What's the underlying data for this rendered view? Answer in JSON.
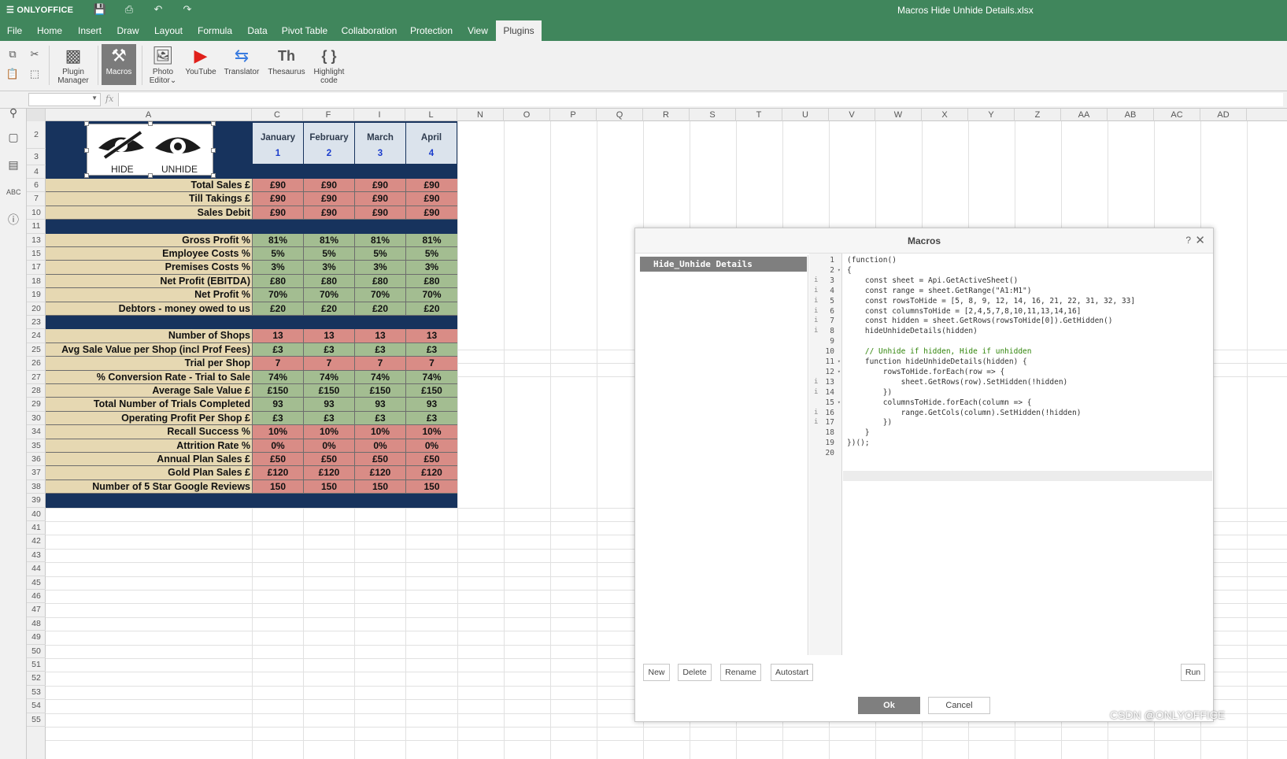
{
  "app": {
    "brand": "ONLYOFFICE",
    "doc_title": "Macros Hide Unhide Details.xlsx"
  },
  "quick_access": {
    "save_icon": "save-icon",
    "print_icon": "print-icon",
    "undo_icon": "undo-icon",
    "redo_icon": "redo-icon"
  },
  "menu": [
    "File",
    "Home",
    "Insert",
    "Draw",
    "Layout",
    "Formula",
    "Data",
    "Pivot Table",
    "Collaboration",
    "Protection",
    "View",
    "Plugins"
  ],
  "active_menu": "Plugins",
  "toolbar": {
    "plugin_manager": [
      "Plugin",
      "Manager"
    ],
    "macros": "Macros",
    "photo_editor": [
      "Photo",
      "Editor"
    ],
    "youtube": "YouTube",
    "translator": "Translator",
    "thesaurus": "Thesaurus",
    "highlight_code": [
      "Highlight",
      "code"
    ]
  },
  "formula_bar": {
    "name_box": "",
    "fx": "fx",
    "value": ""
  },
  "columns": [
    "A",
    "C",
    "F",
    "I",
    "L",
    "N",
    "O",
    "P",
    "Q",
    "R",
    "S",
    "T",
    "U",
    "V",
    "W",
    "X",
    "Y",
    "Z",
    "AA",
    "AB",
    "AC",
    "AD"
  ],
  "rows": [
    "2",
    "3",
    "4",
    "6",
    "7",
    "10",
    "11",
    "13",
    "15",
    "17",
    "18",
    "19",
    "20",
    "23",
    "24",
    "25",
    "26",
    "27",
    "28",
    "29",
    "30",
    "34",
    "35",
    "36",
    "37",
    "38",
    "39",
    "40",
    "41",
    "42",
    "43",
    "44",
    "45",
    "46",
    "47",
    "48",
    "49",
    "50",
    "51",
    "52",
    "53",
    "54",
    "55"
  ],
  "hide_unhide": {
    "hide": "HIDE",
    "unhide": "UNHIDE"
  },
  "months": [
    {
      "name": "January",
      "num": "1"
    },
    {
      "name": "February",
      "num": "2"
    },
    {
      "name": "March",
      "num": "3"
    },
    {
      "name": "April",
      "num": "4"
    }
  ],
  "data_rows": [
    {
      "label": "Total Sales £",
      "values": [
        "£90",
        "£90",
        "£90",
        "£90"
      ],
      "color": "red"
    },
    {
      "label": "Till Takings £",
      "values": [
        "£90",
        "£90",
        "£90",
        "£90"
      ],
      "color": "red"
    },
    {
      "label": "Sales Debit",
      "values": [
        "£90",
        "£90",
        "£90",
        "£90"
      ],
      "color": "red"
    },
    {
      "label": "Gross Profit %",
      "values": [
        "81%",
        "81%",
        "81%",
        "81%"
      ],
      "color": "green"
    },
    {
      "label": "Employee Costs %",
      "values": [
        "5%",
        "5%",
        "5%",
        "5%"
      ],
      "color": "green"
    },
    {
      "label": "Premises Costs %",
      "values": [
        "3%",
        "3%",
        "3%",
        "3%"
      ],
      "color": "green"
    },
    {
      "label": "Net Profit (EBITDA)",
      "values": [
        "£80",
        "£80",
        "£80",
        "£80"
      ],
      "color": "green"
    },
    {
      "label": "Net Profit %",
      "values": [
        "70%",
        "70%",
        "70%",
        "70%"
      ],
      "color": "green"
    },
    {
      "label": "Debtors - money owed to us",
      "values": [
        "£20",
        "£20",
        "£20",
        "£20"
      ],
      "color": "green"
    },
    {
      "label": "Number of Shops",
      "values": [
        "13",
        "13",
        "13",
        "13"
      ],
      "color": "red"
    },
    {
      "label": "Avg Sale Value per Shop (incl Prof Fees)",
      "values": [
        "£3",
        "£3",
        "£3",
        "£3"
      ],
      "color": "green"
    },
    {
      "label": "Trial per Shop",
      "values": [
        "7",
        "7",
        "7",
        "7"
      ],
      "color": "red"
    },
    {
      "label": "% Conversion Rate - Trial to Sale",
      "values": [
        "74%",
        "74%",
        "74%",
        "74%"
      ],
      "color": "green"
    },
    {
      "label": "Average Sale Value £",
      "values": [
        "£150",
        "£150",
        "£150",
        "£150"
      ],
      "color": "green"
    },
    {
      "label": "Total Number of Trials Completed",
      "values": [
        "93",
        "93",
        "93",
        "93"
      ],
      "color": "green"
    },
    {
      "label": "Operating Profit Per Shop £",
      "values": [
        "£3",
        "£3",
        "£3",
        "£3"
      ],
      "color": "green"
    },
    {
      "label": "Recall Success %",
      "values": [
        "10%",
        "10%",
        "10%",
        "10%"
      ],
      "color": "red"
    },
    {
      "label": "Attrition Rate %",
      "values": [
        "0%",
        "0%",
        "0%",
        "0%"
      ],
      "color": "red"
    },
    {
      "label": "Annual Plan Sales £",
      "values": [
        "£50",
        "£50",
        "£50",
        "£50"
      ],
      "color": "red"
    },
    {
      "label": "Gold Plan Sales £",
      "values": [
        "£120",
        "£120",
        "£120",
        "£120"
      ],
      "color": "red"
    },
    {
      "label": "Number of 5 Star Google Reviews",
      "values": [
        "150",
        "150",
        "150",
        "150"
      ],
      "color": "red"
    }
  ],
  "macros_dialog": {
    "title": "Macros",
    "help": "?",
    "macro_items": [
      "Hide_Unhide Details"
    ],
    "line_numbers": [
      "1",
      "2",
      "3",
      "4",
      "5",
      "6",
      "7",
      "8",
      "9",
      "10",
      "11",
      "12",
      "13",
      "14",
      "15",
      "16",
      "17",
      "18",
      "19",
      "20"
    ],
    "code": [
      "(function()",
      "{",
      "    const sheet = Api.GetActiveSheet()",
      "    const range = sheet.GetRange(\"A1:M1\")",
      "    const rowsToHide = [5, 8, 9, 12, 14, 16, 21, 22, 31, 32, 33]",
      "    const columnsToHide = [2,4,5,7,8,10,11,13,14,16]",
      "    const hidden = sheet.GetRows(rowsToHide[0]).GetHidden()",
      "    hideUnhideDetails(hidden)",
      "",
      "    // Unhide if hidden, Hide if unhidden",
      "    function hideUnhideDetails(hidden) {",
      "        rowsToHide.forEach(row => {",
      "            sheet.GetRows(row).SetHidden(!hidden)",
      "        })",
      "        columnsToHide.forEach(column => {",
      "            range.GetCols(column).SetHidden(!hidden)",
      "        })",
      "    }",
      "})();",
      ""
    ],
    "buttons": {
      "new": "New",
      "delete": "Delete",
      "rename": "Rename",
      "autostart": "Autostart",
      "run": "Run",
      "ok": "Ok",
      "cancel": "Cancel"
    }
  },
  "watermark": "CSDN @ONLYOFFICE"
}
